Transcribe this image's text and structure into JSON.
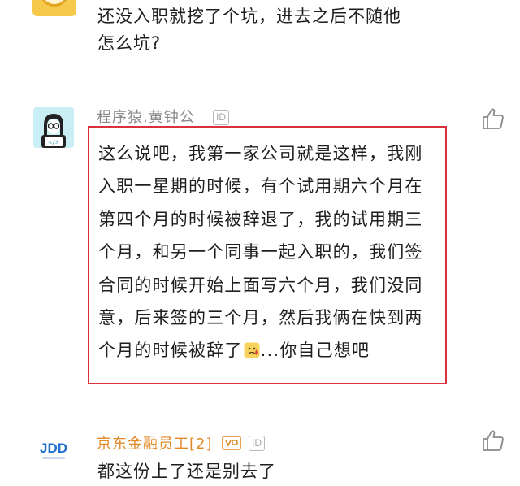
{
  "comments": [
    {
      "username": "",
      "text_line1": "还没入职就挖了个坑，进去之后不随他",
      "text_line2": "怎么坑?"
    },
    {
      "username": "程序猿.黄钟公",
      "id_badge": "ID",
      "text_part1": "这么说吧，我第一家公司就是这样，我刚入职一星期的时候，有个试用期六个月在第四个月的时候被辞退了，我的试用期三个月，和另一个同事一起入职的，我们签合同的时候开始上面写六个月，我们没同意，后来签的三个月，然后我俩在快到两个月的时候被辞了",
      "emoji": "sweat-face-emoji",
      "text_part2": "...你自己想吧",
      "avatar_icon": "programmer-avatar-icon",
      "avatar_color": "#c9eef3"
    },
    {
      "username": "京东金融员工[2]",
      "id_badge": "ID",
      "text": "都这份上了还是别去了",
      "avatar_icon": "jdd-logo-icon",
      "avatar_logo_text": "JDD",
      "username_color": "#e08a2a"
    }
  ],
  "colors": {
    "highlight_border": "#d9323c",
    "username_gray": "#8a8a8a",
    "text": "#1f1f1f"
  }
}
